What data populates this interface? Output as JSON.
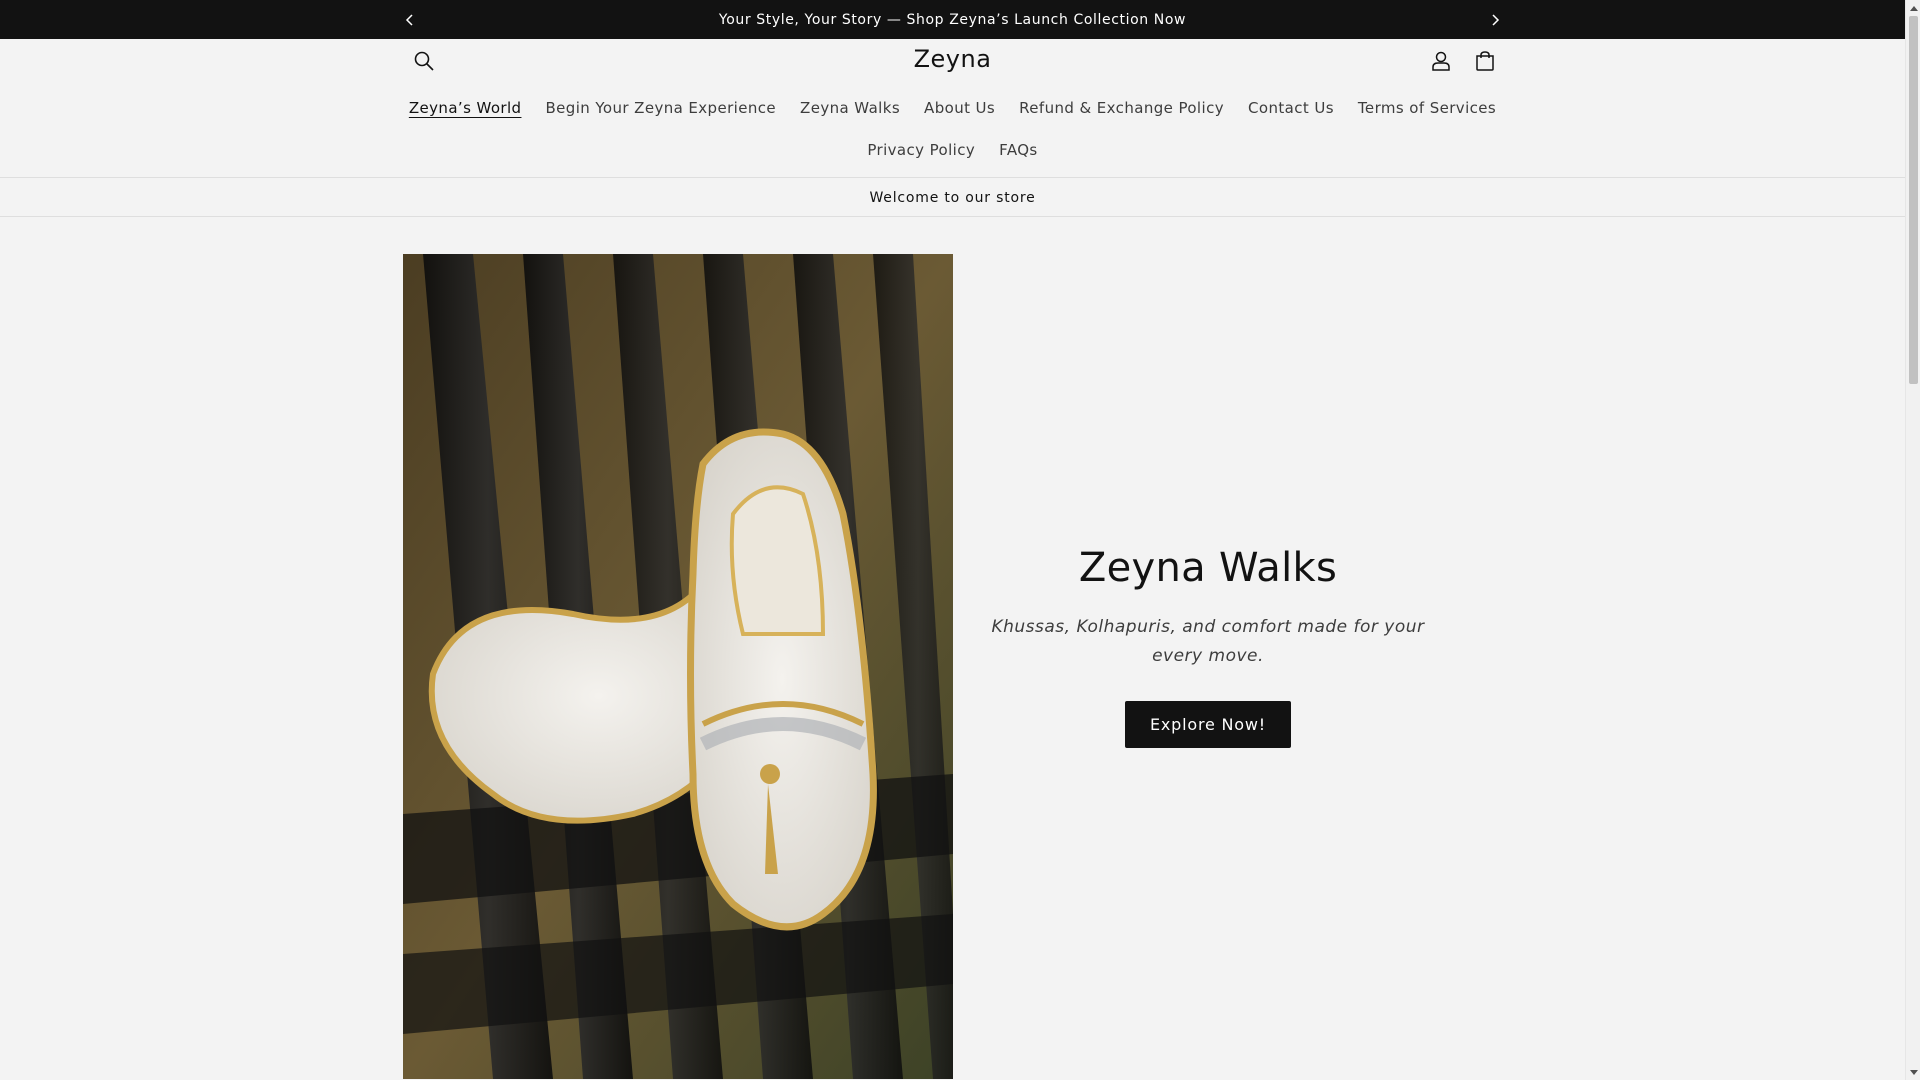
{
  "announcement": {
    "text": "Your Style, Your Story — Shop Zeyna’s Launch Collection Now",
    "prev_icon": "chevron-left-icon",
    "next_icon": "chevron-right-icon"
  },
  "header": {
    "logo": "Zeyna",
    "search_icon": "search-icon",
    "account_icon": "account-icon",
    "cart_icon": "cart-icon"
  },
  "nav": {
    "row1": [
      {
        "label": "Zeyna’s World",
        "active": true
      },
      {
        "label": "Begin Your Zeyna Experience"
      },
      {
        "label": "Zeyna Walks"
      },
      {
        "label": "About Us"
      },
      {
        "label": "Refund & Exchange Policy"
      },
      {
        "label": "Contact Us"
      },
      {
        "label": "Terms of Services"
      }
    ],
    "row2": [
      {
        "label": "Privacy Policy"
      },
      {
        "label": "FAQs"
      }
    ]
  },
  "welcome": "Welcome to our store",
  "hero": {
    "title": "Zeyna Walks",
    "subtitle": "Khussas, Kolhapuris, and comfort made for your every move.",
    "button": "Explore Now!",
    "image_subject": "shoes-photo"
  },
  "colors": {
    "background": "#f3f3f3",
    "text": "#121212",
    "button": "#121212",
    "announcement_bg": "#121212"
  }
}
